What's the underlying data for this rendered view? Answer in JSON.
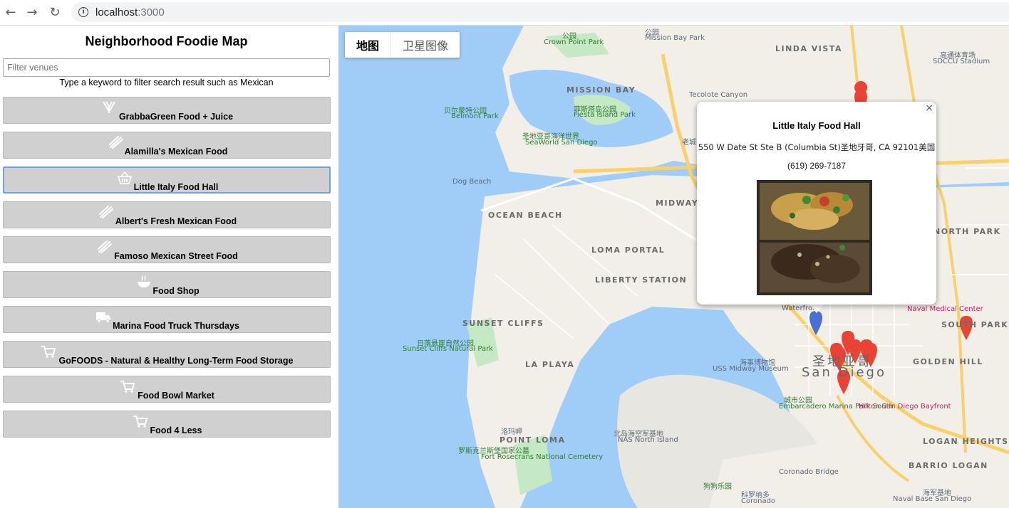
{
  "browser": {
    "url_host": "localhost",
    "url_port": ":3000"
  },
  "app": {
    "title": "Neighborhood Foodie Map",
    "filter_placeholder": "Filter venues",
    "filter_value": "",
    "filter_hint": "Type a keyword to filter search result such as Mexican"
  },
  "venues": [
    {
      "label": "GrabbaGreen Food + Juice",
      "icon": "salad-icon",
      "active": false
    },
    {
      "label": "Alamilla's Mexican Food",
      "icon": "burrito-icon",
      "active": false
    },
    {
      "label": "Little Italy Food Hall",
      "icon": "basket-icon",
      "active": true
    },
    {
      "label": "Albert's Fresh Mexican Food",
      "icon": "burrito-icon",
      "active": false
    },
    {
      "label": "Famoso Mexican Street Food",
      "icon": "burrito-icon",
      "active": false
    },
    {
      "label": "Food Shop",
      "icon": "bowl-icon",
      "active": false
    },
    {
      "label": "Marina Food Truck Thursdays",
      "icon": "food-truck-icon",
      "active": false
    },
    {
      "label": "GoFOODS - Natural & Healthy Long-Term Food Storage",
      "icon": "cart-icon",
      "active": false
    },
    {
      "label": "Food Bowl Market",
      "icon": "cart-icon",
      "active": false
    },
    {
      "label": "Food 4 Less",
      "icon": "cart-icon",
      "active": false
    }
  ],
  "map": {
    "type_map": "地图",
    "type_satellite": "卫星图像",
    "labels": {
      "mission_bay": "MISSION BAY",
      "ocean_beach": "OCEAN BEACH",
      "loma_portal": "LOMA PORTAL",
      "midway_district": "MIDWAY DISTRICT",
      "liberty_station": "LIBERTY STATION",
      "sunset_cliffs": "SUNSET CLIFFS",
      "la_playa": "LA PLAYA",
      "point_loma": "POINT LOMA",
      "golden_hill": "GOLDEN HILL",
      "south_park": "SOUTH PARK",
      "north_park": "NORTH PARK",
      "logan_heights": "LOGAN HEIGHTS",
      "barrio_logan": "BARRIO LOGAN",
      "linda_vista": "LINDA VISTA",
      "dog_beach": "Dog Beach",
      "fiesta_island_zh": "菲斯塔岛公园",
      "fiesta_island": "Fiesta Island Park",
      "belmont_zh": "贝尔蒙特公园",
      "belmont": "Belmont Park",
      "seaworld_zh": "圣地亚哥海洋世界",
      "seaworld": "SeaWorld San Diego",
      "crown_point_zh": "公园",
      "crown_point": "Crown Point Park",
      "sunset_cliffs_park_zh": "日落悬崖自然公园",
      "sunset_cliffs_park": "Sunset Cliffs Natural Park",
      "uss_midway_zh": "海事博物馆",
      "uss_midway": "USS Midway Museum",
      "san_diego_zh": "圣地亚哥",
      "san_diego": "San Diego",
      "embarcadero_zh": "城市公园",
      "embarcadero": "Embarcadero Marina Park South",
      "hilton": "Hilton San Diego Bayfront",
      "nas_zh": "北岛海空军基地",
      "nas": "NAS North Island",
      "rosecrans_zh": "罗斯克兰斯堡国家公墓",
      "rosecrans": "Fort Rosecrans National Cemetery",
      "coronado_bridge": "Coronado Bridge",
      "coronado_zh": "科罗纳多",
      "coronado": "Coronado",
      "coronado_beach_zh": "狗狗乐园",
      "naval_base_zh": "海军基地",
      "naval_base": "Naval Base San Diego",
      "naval_medical": "Naval Medical Center",
      "point_loma_zh": "洛玛岬",
      "sdccu_zh": "高通体育场",
      "sdccu": "SDCCU Stadium",
      "mission_bay_park_zh": "公园",
      "mission_bay_park": "Mission Bay Park",
      "waterfront": "Waterfront",
      "old_town_zh": "老城",
      "tecolote": "Tecolote Canyon"
    }
  },
  "info_window": {
    "name": "Little Italy Food Hall",
    "address": "550 W Date St Ste B (Columbia St)圣地牙哥, CA 92101美国",
    "phone": "(619) 269-7187",
    "close": "×"
  },
  "colors": {
    "water": "#9fcdf7",
    "land": "#f2efe9",
    "park": "#c5e8c5",
    "highway": "#f8d16c",
    "marker_red": "#ea4335",
    "marker_blue": "#4a6fd1",
    "active_border": "#6ea1e8"
  }
}
